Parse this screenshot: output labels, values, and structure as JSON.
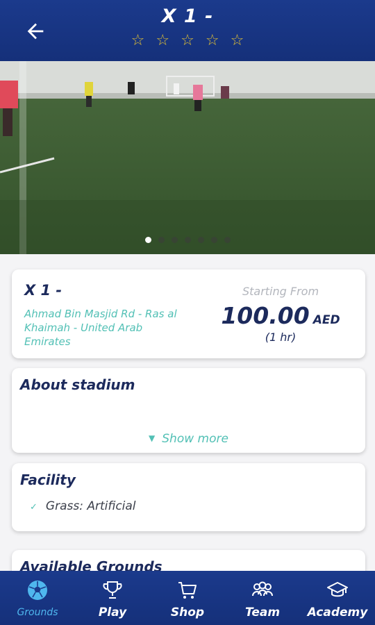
{
  "header": {
    "title": "X 1 -",
    "rating_stars": 5,
    "back_icon": "arrow-left-icon"
  },
  "gallery": {
    "image_description": "Football pitch with artificial grass and players",
    "total_slides": 7,
    "active_slide": 1
  },
  "info_card": {
    "name": "X 1 -",
    "address": "Ahmad Bin Masjid Rd - Ras al Khaimah - United Arab Emirates",
    "starting_from_label": "Starting From",
    "price": "100.00",
    "currency": "AED",
    "duration": "(1 hr)"
  },
  "about": {
    "title": "About stadium",
    "show_more_label": "Show more"
  },
  "facility": {
    "title": "Facility",
    "items": [
      "Grass: Artificial"
    ]
  },
  "available_grounds": {
    "title": "Available Grounds"
  },
  "bottom_nav": {
    "items": [
      {
        "label": "Grounds",
        "icon": "soccer-ball-icon",
        "active": true
      },
      {
        "label": "Play",
        "icon": "trophy-icon",
        "active": false
      },
      {
        "label": "Shop",
        "icon": "cart-icon",
        "active": false
      },
      {
        "label": "Team",
        "icon": "team-icon",
        "active": false
      },
      {
        "label": "Academy",
        "icon": "graduation-cap-icon",
        "active": false
      }
    ]
  },
  "colors": {
    "primary": "#1b3a8c",
    "accent": "#52c0b5",
    "star": "#e1c035",
    "active_nav": "#4fb7ee"
  }
}
